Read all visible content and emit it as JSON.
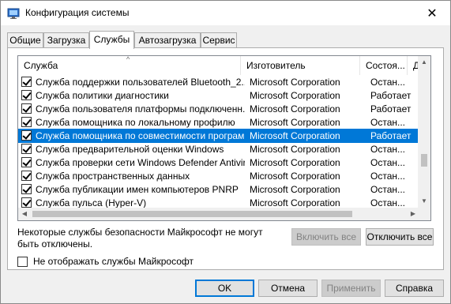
{
  "window": {
    "title": "Конфигурация системы",
    "close_glyph": "✕"
  },
  "tabs": [
    {
      "label": "Общие"
    },
    {
      "label": "Загрузка"
    },
    {
      "label": "Службы"
    },
    {
      "label": "Автозагрузка"
    },
    {
      "label": "Сервис"
    }
  ],
  "services": {
    "sort_indicator": "^",
    "columns": {
      "service": "Служба",
      "manufacturer": "Изготовитель",
      "status": "Состоя...",
      "date": "Д"
    },
    "rows": [
      {
        "name": "Служба поддержки пользователей Bluetooth_2...",
        "manufacturer": "Microsoft Corporation",
        "status": "Остан...",
        "checked": true,
        "selected": false
      },
      {
        "name": "Служба политики диагностики",
        "manufacturer": "Microsoft Corporation",
        "status": "Работает",
        "checked": true,
        "selected": false
      },
      {
        "name": "Служба пользователя платформы подключенн...",
        "manufacturer": "Microsoft Corporation",
        "status": "Работает",
        "checked": true,
        "selected": false
      },
      {
        "name": "Служба помощника по локальному профилю",
        "manufacturer": "Microsoft Corporation",
        "status": "Остан...",
        "checked": true,
        "selected": false
      },
      {
        "name": "Служба помощника по совместимости программ",
        "manufacturer": "Microsoft Corporation",
        "status": "Работает",
        "checked": true,
        "selected": true
      },
      {
        "name": "Служба предварительной оценки Windows",
        "manufacturer": "Microsoft Corporation",
        "status": "Остан...",
        "checked": true,
        "selected": false
      },
      {
        "name": "Служба проверки сети Windows Defender Antivirus",
        "manufacturer": "Microsoft Corporation",
        "status": "Остан...",
        "checked": true,
        "selected": false
      },
      {
        "name": "Служба пространственных данных",
        "manufacturer": "Microsoft Corporation",
        "status": "Остан...",
        "checked": true,
        "selected": false
      },
      {
        "name": "Служба публикации имен компьютеров PNRP",
        "manufacturer": "Microsoft Corporation",
        "status": "Остан...",
        "checked": true,
        "selected": false
      },
      {
        "name": "Служба пульса (Hyper-V)",
        "manufacturer": "Microsoft Corporation",
        "status": "Остан...",
        "checked": true,
        "selected": false
      }
    ]
  },
  "note": "Некоторые службы безопасности Майкрософт не могут быть отключены.",
  "buttons": {
    "enable_all": "Включить все",
    "disable_all": "Отключить все",
    "ok": "OK",
    "cancel": "Отмена",
    "apply": "Применить",
    "help": "Справка"
  },
  "hide_ms": {
    "label": "Не отображать службы Майкрософт",
    "checked": false
  },
  "colors": {
    "selection": "#0078d7",
    "accent": "#0078d7"
  }
}
